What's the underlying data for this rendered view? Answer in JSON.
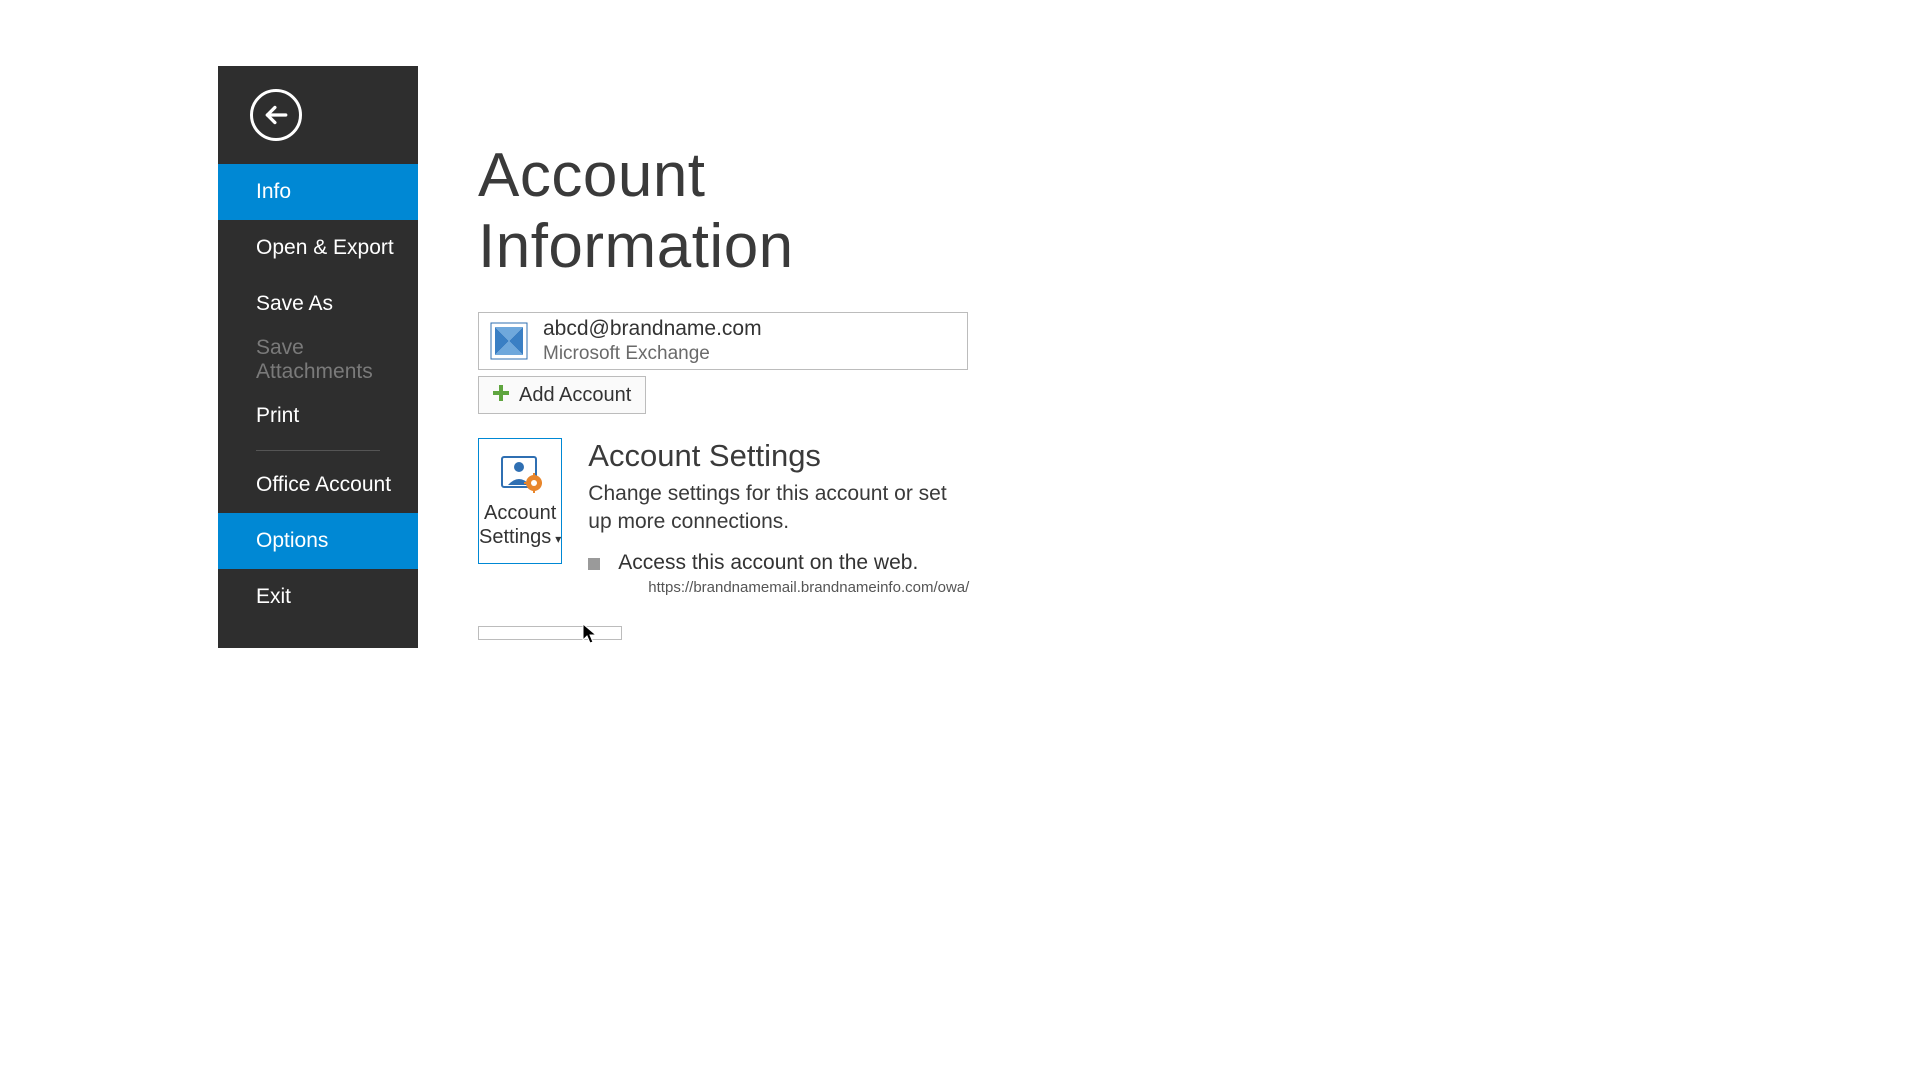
{
  "sidebar": {
    "items": [
      {
        "label": "Info"
      },
      {
        "label": "Open & Export"
      },
      {
        "label": "Save As"
      },
      {
        "label": "Save Attachments"
      },
      {
        "label": "Print"
      },
      {
        "label": "Office Account"
      },
      {
        "label": "Options"
      },
      {
        "label": "Exit"
      }
    ]
  },
  "main": {
    "title": "Account Information",
    "account": {
      "email": "abcd@brandname.com",
      "type": "Microsoft Exchange"
    },
    "add_account_label": "Add Account",
    "account_settings": {
      "tile_line1": "Account",
      "tile_line2": "Settings",
      "heading": "Account Settings",
      "description": "Change settings for this account or set up more connections.",
      "bullet_text": "Access this account on the web.",
      "bullet_url": "https://brandnamemail.brandnameinfo.com/owa/"
    }
  }
}
